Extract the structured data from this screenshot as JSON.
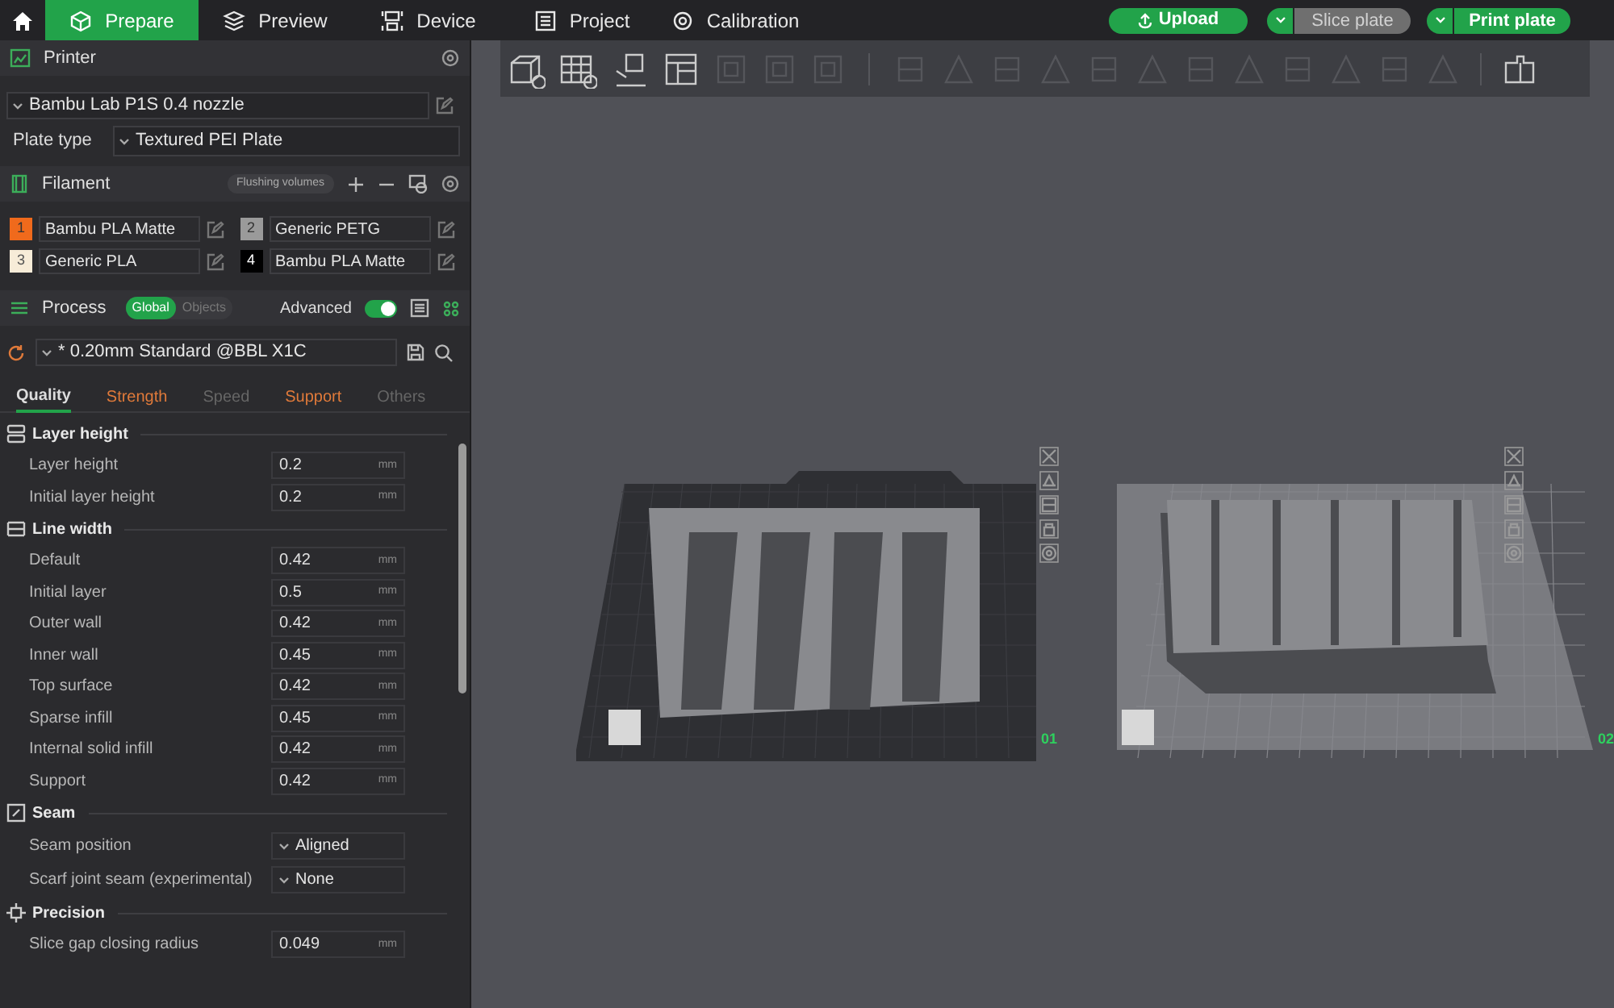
{
  "nav": {
    "tabs": [
      {
        "label": "Prepare",
        "kind": "cube",
        "selected": true
      },
      {
        "label": "Preview",
        "kind": "layers",
        "selected": false
      },
      {
        "label": "Device",
        "kind": "device",
        "selected": false
      },
      {
        "label": "Project",
        "kind": "list",
        "selected": false
      },
      {
        "label": "Calibration",
        "kind": "gear",
        "selected": false
      }
    ]
  },
  "actions": {
    "upload": "Upload",
    "slice": {
      "label": "Slice plate",
      "disabled": true
    },
    "print": {
      "label": "Print plate",
      "disabled": false
    }
  },
  "printer": {
    "title": "Printer",
    "preset": "Bambu Lab P1S 0.4 nozzle",
    "plate_label": "Plate type",
    "plate_value": "Textured PEI Plate"
  },
  "filament": {
    "title": "Filament",
    "flushing": "Flushing volumes",
    "items": [
      {
        "number": "1",
        "name": "Bambu PLA Matte",
        "color": "#f06a1c"
      },
      {
        "number": "2",
        "name": "Generic PETG",
        "color": "#9a9a9a"
      },
      {
        "number": "3",
        "name": "Generic PLA",
        "color": "#f7ecd8"
      },
      {
        "number": "4",
        "name": "Bambu PLA Matte",
        "color": "#000000"
      }
    ]
  },
  "process": {
    "title": "Process",
    "scopes": [
      {
        "label": "Global",
        "selected": true
      },
      {
        "label": "Objects",
        "selected": false
      }
    ],
    "advanced": {
      "label": "Advanced",
      "on": true
    },
    "preset": "* 0.20mm Standard @BBL X1C",
    "tabs": [
      {
        "label": "Quality",
        "selected": true,
        "modified": false
      },
      {
        "label": "Strength",
        "selected": false,
        "modified": true
      },
      {
        "label": "Speed",
        "selected": false,
        "modified": false
      },
      {
        "label": "Support",
        "selected": false,
        "modified": true
      },
      {
        "label": "Others",
        "selected": false,
        "modified": false
      }
    ]
  },
  "sections": [
    {
      "title": "Layer height",
      "kind": "layers",
      "rows": [
        {
          "label": "Layer height",
          "kind": "number",
          "value": "0.2",
          "unit": "mm"
        },
        {
          "label": "Initial layer height",
          "kind": "number",
          "value": "0.2",
          "unit": "mm"
        }
      ]
    },
    {
      "title": "Line width",
      "kind": "lines",
      "rows": [
        {
          "label": "Default",
          "kind": "number",
          "value": "0.42",
          "unit": "mm"
        },
        {
          "label": "Initial layer",
          "kind": "number",
          "value": "0.5",
          "unit": "mm"
        },
        {
          "label": "Outer wall",
          "kind": "number",
          "value": "0.42",
          "unit": "mm"
        },
        {
          "label": "Inner wall",
          "kind": "number",
          "value": "0.45",
          "unit": "mm"
        },
        {
          "label": "Top surface",
          "kind": "number",
          "value": "0.42",
          "unit": "mm"
        },
        {
          "label": "Sparse infill",
          "kind": "number",
          "value": "0.45",
          "unit": "mm"
        },
        {
          "label": "Internal solid infill",
          "kind": "number",
          "value": "0.42",
          "unit": "mm"
        },
        {
          "label": "Support",
          "kind": "number",
          "value": "0.42",
          "unit": "mm"
        }
      ]
    },
    {
      "title": "Seam",
      "kind": "seam",
      "rows": [
        {
          "label": "Seam position",
          "kind": "select",
          "value": "Aligned"
        },
        {
          "label": "Scarf joint seam (experimental)",
          "kind": "select",
          "value": "None"
        }
      ]
    },
    {
      "title": "Precision",
      "kind": "precision",
      "rows": [
        {
          "label": "Slice gap closing radius",
          "kind": "number",
          "value": "0.049",
          "unit": "mm"
        }
      ]
    }
  ],
  "plates": [
    {
      "label": "01",
      "kind": "textured"
    },
    {
      "label": "02",
      "kind": "plain"
    }
  ]
}
